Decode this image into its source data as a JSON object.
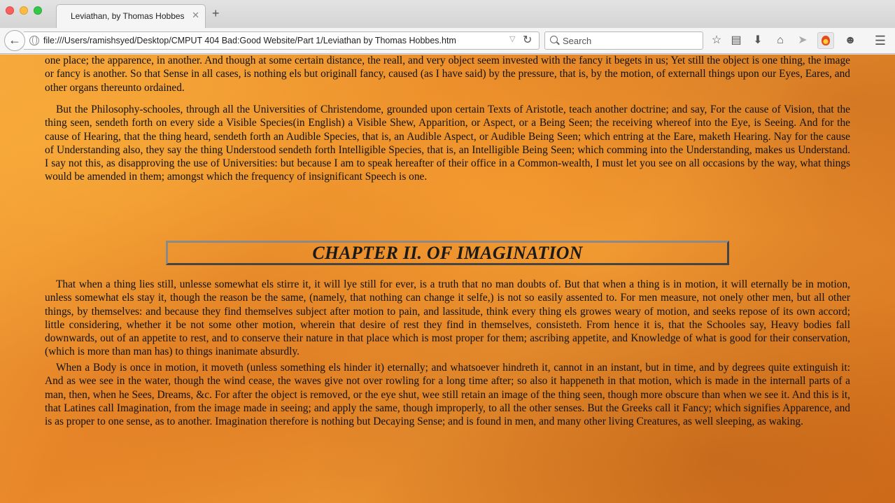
{
  "browser": {
    "tab_title": "Leviathan, by Thomas Hobbes",
    "tab_close": "✕",
    "new_tab": "+",
    "url": "file:///Users/ramishsyed/Desktop/CMPUT 404 Bad:Good Website/Part 1/Leviathan by Thomas Hobbes.htm",
    "search_placeholder": "Search",
    "toolbar_icons": [
      "star-icon",
      "reading-list-icon",
      "download-icon",
      "home-icon",
      "send-icon",
      "extension-icon",
      "chat-icon",
      "menu-icon"
    ]
  },
  "page": {
    "paragraph_top": "one place; the apparence, in another. And though at some certain distance, the reall, and very object seem invested with the fancy it begets in us; Yet still the object is one thing, the image or fancy is another. So that Sense in all cases, is nothing els but originall fancy, caused (as I have said) by the pressure, that is, by the motion, of externall things upon our Eyes, Eares, and other organs thereunto ordained.",
    "paragraph_1": "But the Philosophy-schooles, through all the Universities of Christendome, grounded upon certain Texts of Aristotle, teach another doctrine; and say, For the cause of Vision, that the thing seen, sendeth forth on every side a Visible Species(in English) a Visible Shew, Apparition, or Aspect, or a Being Seen; the receiving whereof into the Eye, is Seeing. And for the cause of Hearing, that the thing heard, sendeth forth an Audible Species, that is, an Audible Aspect, or Audible Being Seen; which entring at the Eare, maketh Hearing. Nay for the cause of Understanding also, they say the thing Understood sendeth forth Intelligible Species, that is, an Intelligible Being Seen; which comming into the Understanding, makes us Understand. I say not this, as disapproving the use of Universities: but because I am to speak hereafter of their office in a Common-wealth, I must let you see on all occasions by the way, what things would be amended in them; amongst which the frequency of insignificant Speech is one.",
    "chapter_title": "CHAPTER II. OF IMAGINATION",
    "paragraph_2": "That when a thing lies still, unlesse somewhat els stirre it, it will lye still for ever, is a truth that no man doubts of. But that when a thing is in motion, it will eternally be in motion, unless somewhat els stay it, though the reason be the same, (namely, that nothing can change it selfe,) is not so easily assented to. For men measure, not onely other men, but all other things, by themselves: and because they find themselves subject after motion to pain, and lassitude, think every thing els growes weary of motion, and seeks repose of its own accord; little considering, whether it be not some other motion, wherein that desire of rest they find in themselves, consisteth. From hence it is, that the Schooles say, Heavy bodies fall downwards, out of an appetite to rest, and to conserve their nature in that place which is most proper for them; ascribing appetite, and Knowledge of what is good for their conservation, (which is more than man has) to things inanimate absurdly.",
    "paragraph_3": "When a Body is once in motion, it moveth (unless something els hinder it) eternally; and whatsoever hindreth it, cannot in an instant, but in time, and by degrees quite extinguish it: And as wee see in the water, though the wind cease, the waves give not over rowling for a long time after; so also it happeneth in that motion, which is made in the internall parts of a man, then, when he Sees, Dreams, &c. For after the object is removed, or the eye shut, wee still retain an image of the thing seen, though more obscure than when we see it. And this is it, that Latines call Imagination, from the image made in seeing; and apply the same, though improperly, to all the other senses. But the Greeks call it Fancy; which signifies Apparence, and is as proper to one sense, as to another. Imagination therefore is nothing but Decaying Sense; and is found in men, and many other living Creatures, as well sleeping, as waking."
  }
}
